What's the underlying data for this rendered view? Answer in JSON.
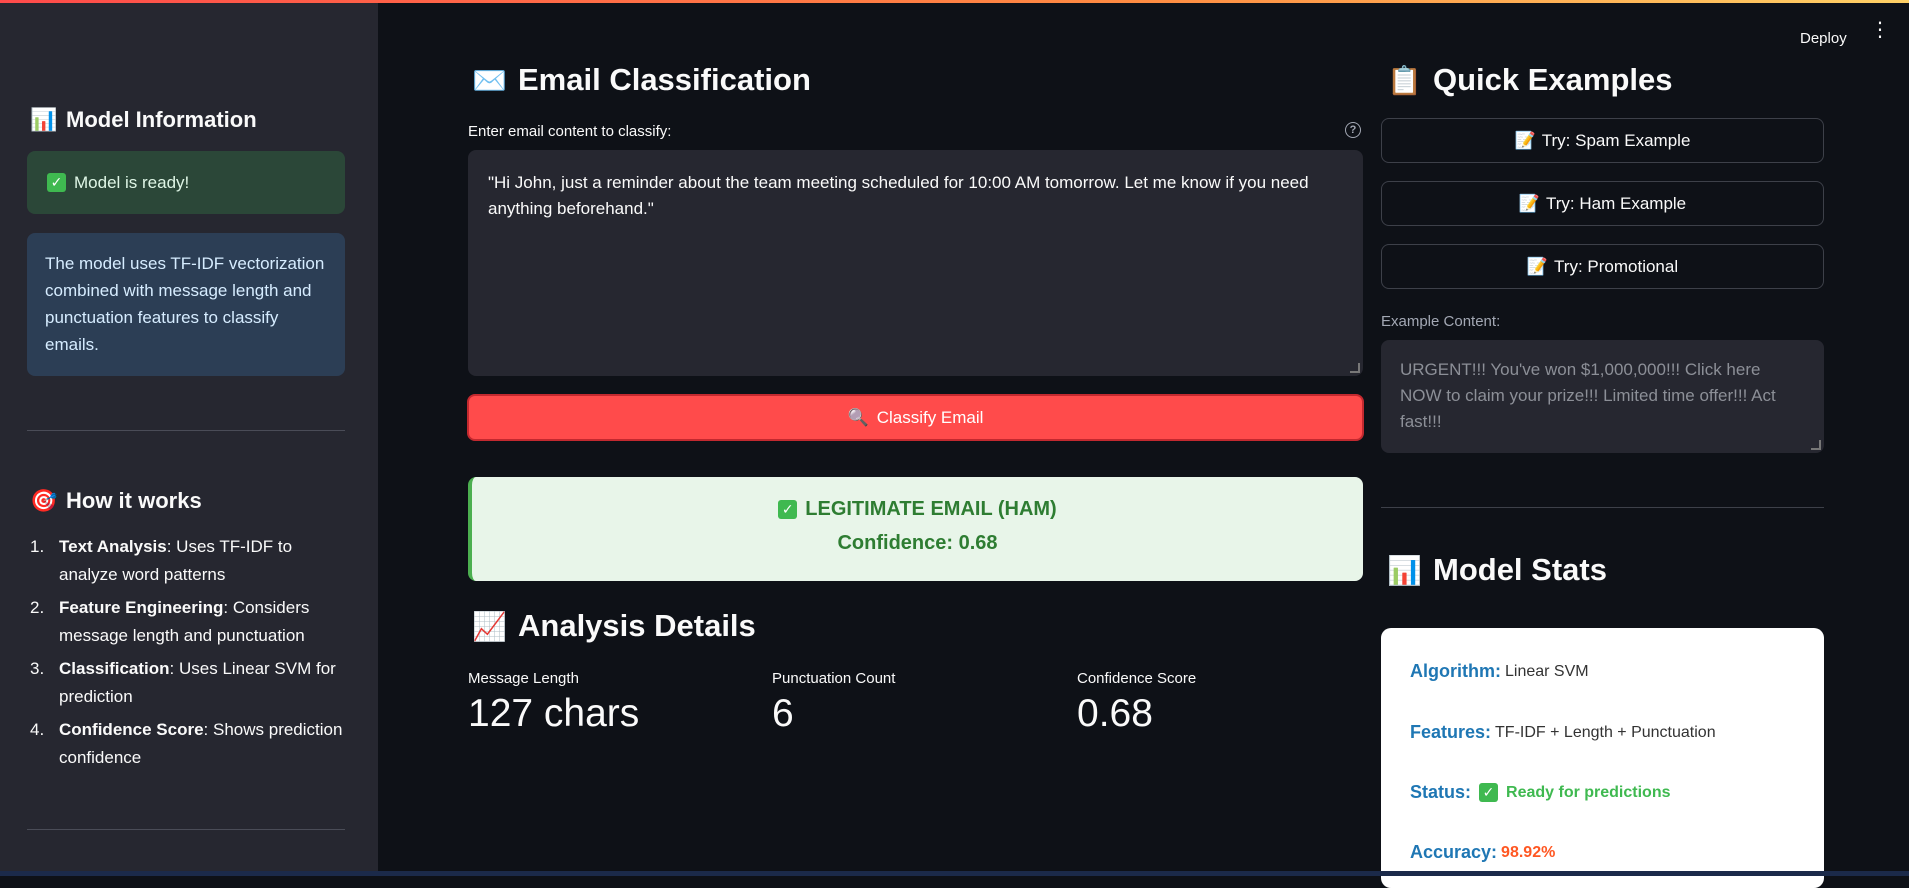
{
  "header": {
    "deploy_label": "Deploy",
    "menu_icon": "kebab-menu-icon"
  },
  "sidebar": {
    "model_info_title": "Model Information",
    "model_info_icon": "bar-chart-icon",
    "status_text": "Model is ready!",
    "info_text": "The model uses TF-IDF vectorization combined with message length and punctuation features to classify emails.",
    "how_title": "How it works",
    "how_icon": "target-icon",
    "steps": [
      {
        "num": "1.",
        "bold": "Text Analysis",
        "text": ": Uses TF-IDF to analyze word patterns"
      },
      {
        "num": "2.",
        "bold": "Feature Engineering",
        "text": ": Considers message length and punctuation"
      },
      {
        "num": "3.",
        "bold": "Classification",
        "text": ": Uses Linear SVM for prediction"
      },
      {
        "num": "4.",
        "bold": "Confidence Score",
        "text": ": Shows prediction confidence"
      }
    ]
  },
  "main": {
    "title": "Email Classification",
    "title_icon": "envelope-icon",
    "input_label": "Enter email content to classify:",
    "input_value": "\"Hi John, just a reminder about the team meeting scheduled for 10:00 AM tomorrow. Let me know if you need anything beforehand.\"",
    "classify_button": "Classify Email",
    "result_title": "LEGITIMATE EMAIL (HAM)",
    "result_confidence": "Confidence: 0.68",
    "analysis_title": "Analysis Details",
    "analysis_icon": "trend-chart-icon",
    "metrics": [
      {
        "label": "Message Length",
        "value": "127 chars"
      },
      {
        "label": "Punctuation Count",
        "value": "6"
      },
      {
        "label": "Confidence Score",
        "value": "0.68"
      }
    ]
  },
  "examples": {
    "title": "Quick Examples",
    "title_icon": "clipboard-icon",
    "buttons": [
      "Try: Spam Example",
      "Try: Ham Example",
      "Try: Promotional"
    ],
    "content_label": "Example Content:",
    "content_value": "URGENT!!! You've won $1,000,000!!! Click here NOW to claim your prize!!! Limited time offer!!! Act fast!!!"
  },
  "stats": {
    "title": "Model Stats",
    "title_icon": "bar-chart-icon",
    "algorithm_key": "Algorithm:",
    "algorithm_val": "Linear SVM",
    "features_key": "Features:",
    "features_val": "TF-IDF + Length + Punctuation",
    "status_key": "Status:",
    "status_val": "Ready for predictions",
    "accuracy_key": "Accuracy:",
    "accuracy_val": "98.92%"
  },
  "colors": {
    "primary": "#ff4b4b",
    "success": "#3fb950",
    "link": "#1f77b4",
    "accuracy": "#ff5722"
  }
}
